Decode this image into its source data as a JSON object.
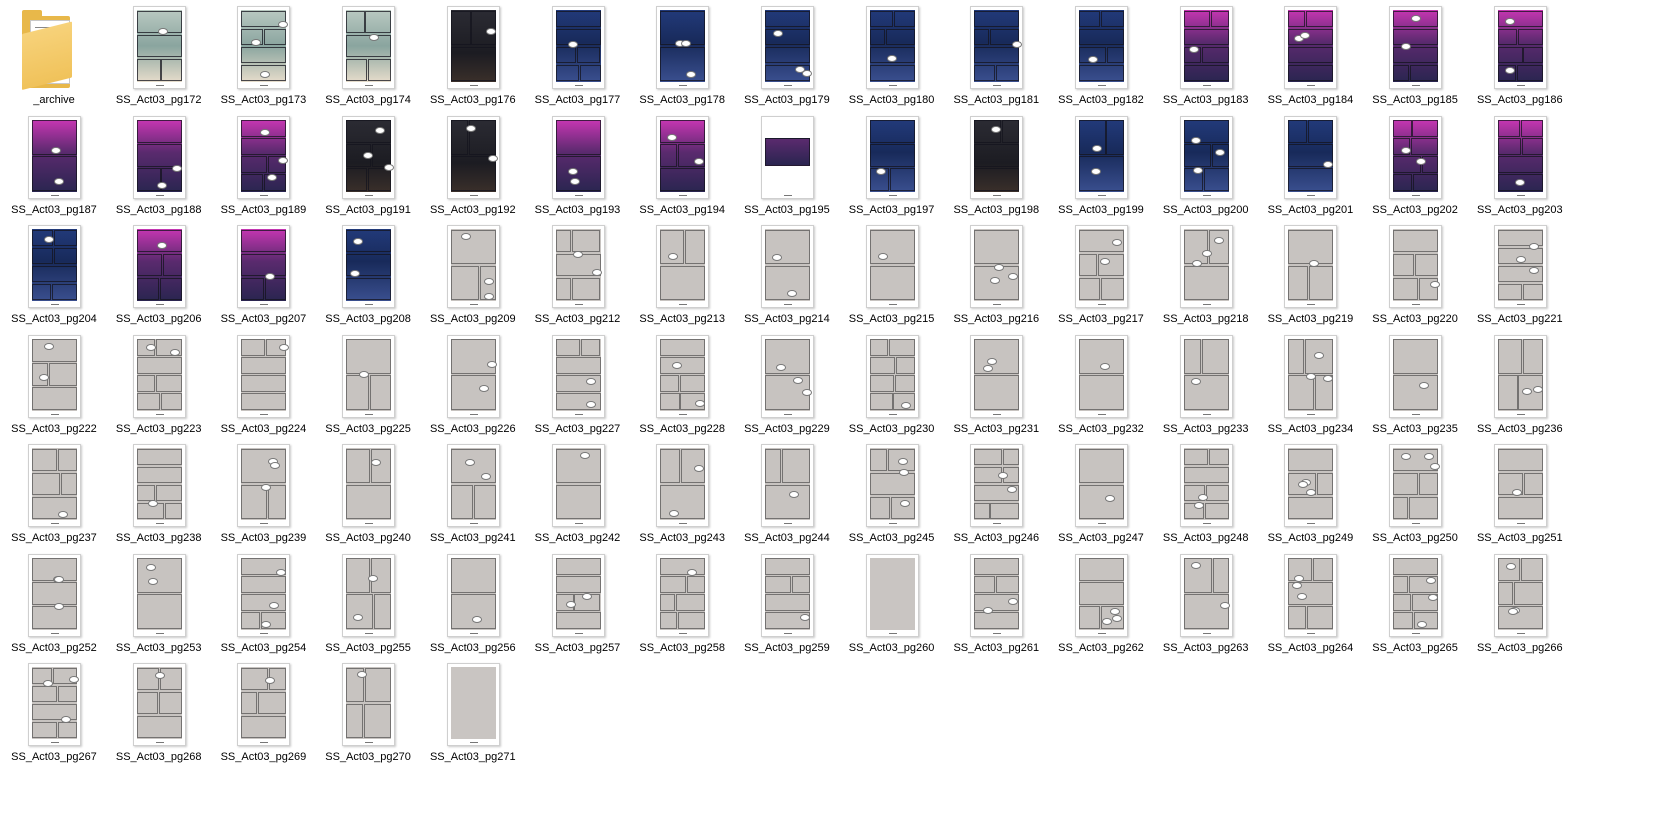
{
  "window": {
    "view": "Large icons"
  },
  "colors": {
    "folder": "#f0c25a",
    "sketch_page": "#c7c3c0",
    "label_text": "#000000"
  },
  "items": [
    {
      "label": "_archive",
      "kind": "folder",
      "icon": "folder-icon"
    },
    {
      "label": "SS_Act03_pg172",
      "kind": "file",
      "theme": "color"
    },
    {
      "label": "SS_Act03_pg173",
      "kind": "file",
      "theme": "color"
    },
    {
      "label": "SS_Act03_pg174",
      "kind": "file",
      "theme": "color"
    },
    {
      "label": "SS_Act03_pg176",
      "kind": "file",
      "theme": "dark"
    },
    {
      "label": "SS_Act03_pg177",
      "kind": "file",
      "theme": "blue"
    },
    {
      "label": "SS_Act03_pg178",
      "kind": "file",
      "theme": "blue"
    },
    {
      "label": "SS_Act03_pg179",
      "kind": "file",
      "theme": "blue"
    },
    {
      "label": "SS_Act03_pg180",
      "kind": "file",
      "theme": "blue"
    },
    {
      "label": "SS_Act03_pg181",
      "kind": "file",
      "theme": "blue"
    },
    {
      "label": "SS_Act03_pg182",
      "kind": "file",
      "theme": "blue"
    },
    {
      "label": "SS_Act03_pg183",
      "kind": "file",
      "theme": "pink"
    },
    {
      "label": "SS_Act03_pg184",
      "kind": "file",
      "theme": "pink"
    },
    {
      "label": "SS_Act03_pg185",
      "kind": "file",
      "theme": "pink"
    },
    {
      "label": "SS_Act03_pg186",
      "kind": "file",
      "theme": "pink"
    },
    {
      "label": "SS_Act03_pg187",
      "kind": "file",
      "theme": "pink"
    },
    {
      "label": "SS_Act03_pg188",
      "kind": "file",
      "theme": "pink"
    },
    {
      "label": "SS_Act03_pg189",
      "kind": "file",
      "theme": "pink"
    },
    {
      "label": "SS_Act03_pg191",
      "kind": "file",
      "theme": "dark"
    },
    {
      "label": "SS_Act03_pg192",
      "kind": "file",
      "theme": "dark"
    },
    {
      "label": "SS_Act03_pg193",
      "kind": "file",
      "theme": "pink"
    },
    {
      "label": "SS_Act03_pg194",
      "kind": "file",
      "theme": "pink"
    },
    {
      "label": "SS_Act03_pg195",
      "kind": "file",
      "theme": "white"
    },
    {
      "label": "SS_Act03_pg197",
      "kind": "file",
      "theme": "blue"
    },
    {
      "label": "SS_Act03_pg198",
      "kind": "file",
      "theme": "dark"
    },
    {
      "label": "SS_Act03_pg199",
      "kind": "file",
      "theme": "blue"
    },
    {
      "label": "SS_Act03_pg200",
      "kind": "file",
      "theme": "blue"
    },
    {
      "label": "SS_Act03_pg201",
      "kind": "file",
      "theme": "blue"
    },
    {
      "label": "SS_Act03_pg202",
      "kind": "file",
      "theme": "pink"
    },
    {
      "label": "SS_Act03_pg203",
      "kind": "file",
      "theme": "pink"
    },
    {
      "label": "SS_Act03_pg204",
      "kind": "file",
      "theme": "blue"
    },
    {
      "label": "SS_Act03_pg206",
      "kind": "file",
      "theme": "pink"
    },
    {
      "label": "SS_Act03_pg207",
      "kind": "file",
      "theme": "pink"
    },
    {
      "label": "SS_Act03_pg208",
      "kind": "file",
      "theme": "blue"
    },
    {
      "label": "SS_Act03_pg209",
      "kind": "file",
      "theme": "sketch"
    },
    {
      "label": "SS_Act03_pg212",
      "kind": "file",
      "theme": "sketch"
    },
    {
      "label": "SS_Act03_pg213",
      "kind": "file",
      "theme": "sketch"
    },
    {
      "label": "SS_Act03_pg214",
      "kind": "file",
      "theme": "sketch"
    },
    {
      "label": "SS_Act03_pg215",
      "kind": "file",
      "theme": "sketch"
    },
    {
      "label": "SS_Act03_pg216",
      "kind": "file",
      "theme": "sketch"
    },
    {
      "label": "SS_Act03_pg217",
      "kind": "file",
      "theme": "sketch"
    },
    {
      "label": "SS_Act03_pg218",
      "kind": "file",
      "theme": "sketch"
    },
    {
      "label": "SS_Act03_pg219",
      "kind": "file",
      "theme": "sketch"
    },
    {
      "label": "SS_Act03_pg220",
      "kind": "file",
      "theme": "sketch"
    },
    {
      "label": "SS_Act03_pg221",
      "kind": "file",
      "theme": "sketch"
    },
    {
      "label": "SS_Act03_pg222",
      "kind": "file",
      "theme": "sketch"
    },
    {
      "label": "SS_Act03_pg223",
      "kind": "file",
      "theme": "sketch"
    },
    {
      "label": "SS_Act03_pg224",
      "kind": "file",
      "theme": "sketch"
    },
    {
      "label": "SS_Act03_pg225",
      "kind": "file",
      "theme": "sketch"
    },
    {
      "label": "SS_Act03_pg226",
      "kind": "file",
      "theme": "sketch"
    },
    {
      "label": "SS_Act03_pg227",
      "kind": "file",
      "theme": "sketch"
    },
    {
      "label": "SS_Act03_pg228",
      "kind": "file",
      "theme": "sketch"
    },
    {
      "label": "SS_Act03_pg229",
      "kind": "file",
      "theme": "sketch"
    },
    {
      "label": "SS_Act03_pg230",
      "kind": "file",
      "theme": "sketch"
    },
    {
      "label": "SS_Act03_pg231",
      "kind": "file",
      "theme": "sketch"
    },
    {
      "label": "SS_Act03_pg232",
      "kind": "file",
      "theme": "sketch"
    },
    {
      "label": "SS_Act03_pg233",
      "kind": "file",
      "theme": "sketch"
    },
    {
      "label": "SS_Act03_pg234",
      "kind": "file",
      "theme": "sketch"
    },
    {
      "label": "SS_Act03_pg235",
      "kind": "file",
      "theme": "sketch"
    },
    {
      "label": "SS_Act03_pg236",
      "kind": "file",
      "theme": "sketch"
    },
    {
      "label": "SS_Act03_pg237",
      "kind": "file",
      "theme": "sketch"
    },
    {
      "label": "SS_Act03_pg238",
      "kind": "file",
      "theme": "sketch"
    },
    {
      "label": "SS_Act03_pg239",
      "kind": "file",
      "theme": "sketch"
    },
    {
      "label": "SS_Act03_pg240",
      "kind": "file",
      "theme": "sketch"
    },
    {
      "label": "SS_Act03_pg241",
      "kind": "file",
      "theme": "sketch"
    },
    {
      "label": "SS_Act03_pg242",
      "kind": "file",
      "theme": "sketch"
    },
    {
      "label": "SS_Act03_pg243",
      "kind": "file",
      "theme": "sketch"
    },
    {
      "label": "SS_Act03_pg244",
      "kind": "file",
      "theme": "sketch"
    },
    {
      "label": "SS_Act03_pg245",
      "kind": "file",
      "theme": "sketch"
    },
    {
      "label": "SS_Act03_pg246",
      "kind": "file",
      "theme": "sketch"
    },
    {
      "label": "SS_Act03_pg247",
      "kind": "file",
      "theme": "sketch"
    },
    {
      "label": "SS_Act03_pg248",
      "kind": "file",
      "theme": "sketch"
    },
    {
      "label": "SS_Act03_pg249",
      "kind": "file",
      "theme": "sketch"
    },
    {
      "label": "SS_Act03_pg250",
      "kind": "file",
      "theme": "sketch"
    },
    {
      "label": "SS_Act03_pg251",
      "kind": "file",
      "theme": "sketch"
    },
    {
      "label": "SS_Act03_pg252",
      "kind": "file",
      "theme": "sketch"
    },
    {
      "label": "SS_Act03_pg253",
      "kind": "file",
      "theme": "sketch"
    },
    {
      "label": "SS_Act03_pg254",
      "kind": "file",
      "theme": "sketch"
    },
    {
      "label": "SS_Act03_pg255",
      "kind": "file",
      "theme": "sketch"
    },
    {
      "label": "SS_Act03_pg256",
      "kind": "file",
      "theme": "sketch"
    },
    {
      "label": "SS_Act03_pg257",
      "kind": "file",
      "theme": "sketch"
    },
    {
      "label": "SS_Act03_pg258",
      "kind": "file",
      "theme": "sketch"
    },
    {
      "label": "SS_Act03_pg259",
      "kind": "file",
      "theme": "sketch"
    },
    {
      "label": "SS_Act03_pg260",
      "kind": "file",
      "theme": "blank"
    },
    {
      "label": "SS_Act03_pg261",
      "kind": "file",
      "theme": "sketch"
    },
    {
      "label": "SS_Act03_pg262",
      "kind": "file",
      "theme": "sketch"
    },
    {
      "label": "SS_Act03_pg263",
      "kind": "file",
      "theme": "sketch"
    },
    {
      "label": "SS_Act03_pg264",
      "kind": "file",
      "theme": "sketch"
    },
    {
      "label": "SS_Act03_pg265",
      "kind": "file",
      "theme": "sketch"
    },
    {
      "label": "SS_Act03_pg266",
      "kind": "file",
      "theme": "sketch"
    },
    {
      "label": "SS_Act03_pg267",
      "kind": "file",
      "theme": "sketch"
    },
    {
      "label": "SS_Act03_pg268",
      "kind": "file",
      "theme": "sketch"
    },
    {
      "label": "SS_Act03_pg269",
      "kind": "file",
      "theme": "sketch"
    },
    {
      "label": "SS_Act03_pg270",
      "kind": "file",
      "theme": "sketch"
    },
    {
      "label": "SS_Act03_pg271",
      "kind": "file",
      "theme": "blank"
    }
  ]
}
